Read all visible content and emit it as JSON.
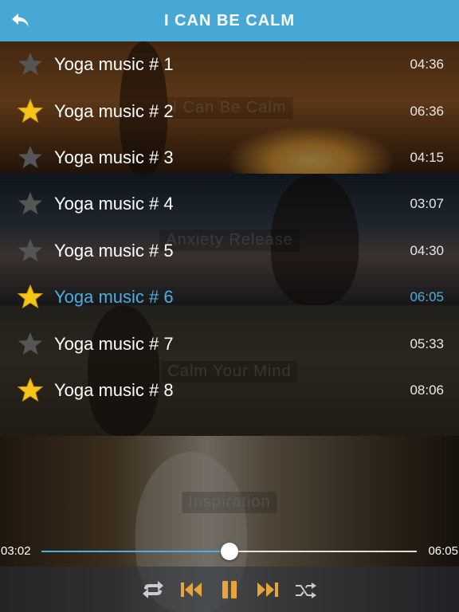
{
  "header": {
    "title": "I CAN BE CALM",
    "back_icon": "back-arrow-icon"
  },
  "background_labels": [
    "I Can Be Calm",
    "Anxiety Release",
    "Calm Your Mind",
    "Inspiration"
  ],
  "tracks": [
    {
      "name": "Yoga music # 1",
      "duration": "04:36",
      "favorite": false,
      "active": false
    },
    {
      "name": "Yoga music # 2",
      "duration": "06:36",
      "favorite": true,
      "active": false
    },
    {
      "name": "Yoga music # 3",
      "duration": "04:15",
      "favorite": false,
      "active": false
    },
    {
      "name": "Yoga music # 4",
      "duration": "03:07",
      "favorite": false,
      "active": false
    },
    {
      "name": "Yoga music # 5",
      "duration": "04:30",
      "favorite": false,
      "active": false
    },
    {
      "name": "Yoga music # 6",
      "duration": "06:05",
      "favorite": true,
      "active": true
    },
    {
      "name": "Yoga music # 7",
      "duration": "05:33",
      "favorite": false,
      "active": false
    },
    {
      "name": "Yoga music # 8",
      "duration": "08:06",
      "favorite": true,
      "active": false
    }
  ],
  "player": {
    "elapsed": "03:02",
    "total": "06:05",
    "progress_fraction": 0.5,
    "controls": [
      "repeat-icon",
      "previous-icon",
      "pause-icon",
      "next-icon",
      "shuffle-icon"
    ]
  },
  "colors": {
    "header_bg": "#48a8d5",
    "active_text": "#4aaee0",
    "star_on": "#f5c518",
    "star_off": "#555555",
    "control_gold": "#e8a33a"
  }
}
